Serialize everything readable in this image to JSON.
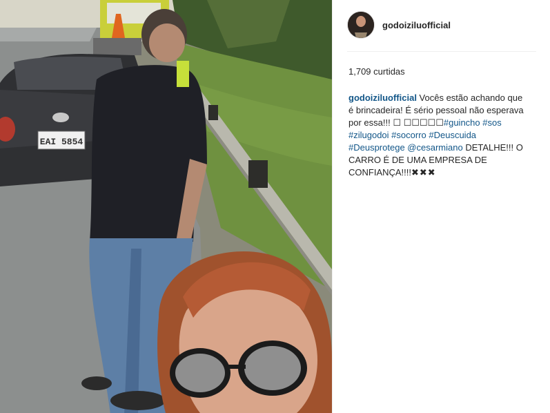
{
  "post": {
    "username": "godoiziluofficial",
    "likes_text": "1,709 curtidas",
    "plate_text": "EAI 5854",
    "caption": {
      "author": "godoiziluofficial",
      "text1": " Vocês estão achando que é brincadeira! É sério pessoal não esperava por essa!!! ",
      "emoji_text": "☐ ☐☐☐☐☐",
      "tags": [
        "#guincho",
        "#sos",
        "#zilugodoi",
        "#socorro",
        "#Deuscuida",
        "#Deusprotege",
        "@cesarmiano"
      ],
      "text2": " DETALHE!!! O CARRO É DE UMA EMPRESA DE CONFIANÇA!!!!",
      "hearts": "✖✖✖"
    }
  },
  "colors": {
    "link": "#125688",
    "text": "#262626"
  },
  "icons": [
    "avatar"
  ]
}
